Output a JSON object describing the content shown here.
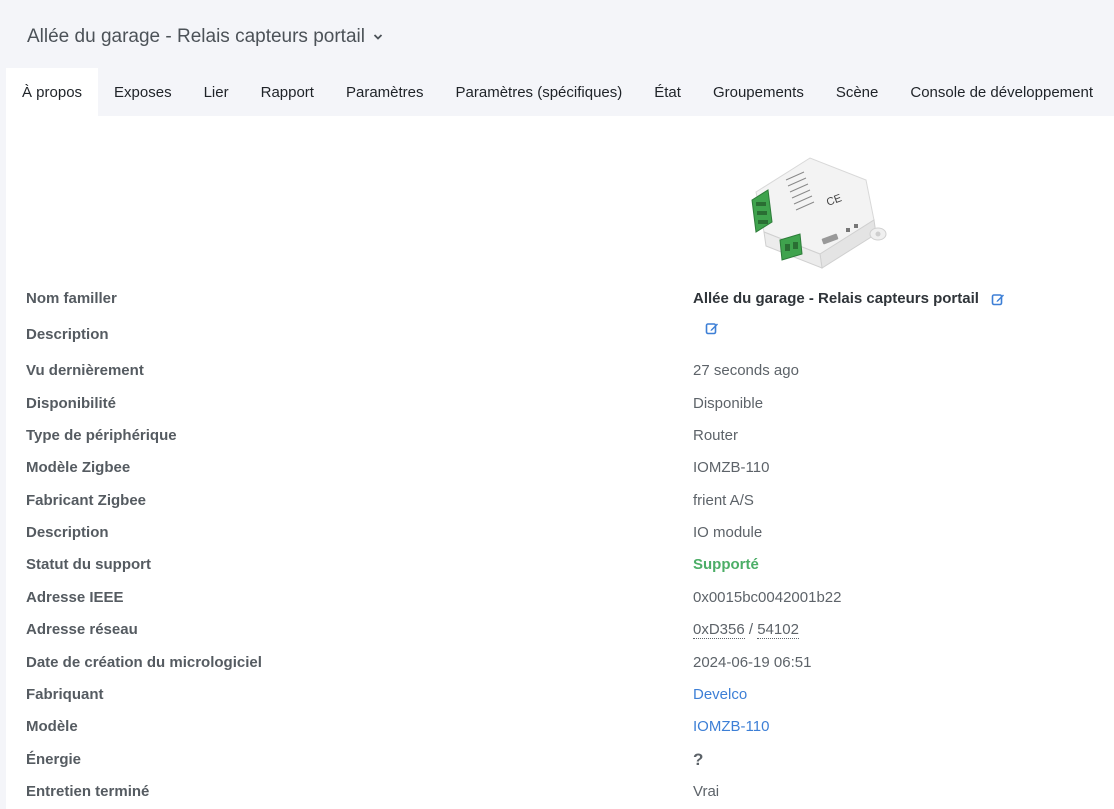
{
  "header": {
    "title": "Allée du garage - Relais capteurs portail"
  },
  "tabs": [
    {
      "label": "À propos",
      "active": true
    },
    {
      "label": "Exposes"
    },
    {
      "label": "Lier"
    },
    {
      "label": "Rapport"
    },
    {
      "label": "Paramètres"
    },
    {
      "label": "Paramètres (spécifiques)"
    },
    {
      "label": "État"
    },
    {
      "label": "Groupements"
    },
    {
      "label": "Scène"
    },
    {
      "label": "Console de développement"
    }
  ],
  "device_image_icon": "device-io-module-image",
  "details": {
    "friendly_name": {
      "label": "Nom familler",
      "value": "Allée du garage - Relais capteurs portail"
    },
    "description_edit": {
      "label": "Description"
    },
    "last_seen": {
      "label": "Vu dernièrement",
      "value": "27 seconds ago"
    },
    "availability": {
      "label": "Disponibilité",
      "value": "Disponible"
    },
    "device_type": {
      "label": "Type de périphérique",
      "value": "Router"
    },
    "zigbee_model": {
      "label": "Modèle Zigbee",
      "value": "IOMZB-110"
    },
    "zigbee_manufacturer": {
      "label": "Fabricant Zigbee",
      "value": "frient A/S"
    },
    "description": {
      "label": "Description",
      "value": "IO module"
    },
    "support_status": {
      "label": "Statut du support",
      "value": "Supporté"
    },
    "ieee_address": {
      "label": "Adresse IEEE",
      "value": "0x0015bc0042001b22"
    },
    "network_address": {
      "label": "Adresse réseau",
      "hex": "0xD356",
      "separator": " / ",
      "dec": "54102"
    },
    "firmware_date": {
      "label": "Date de création du micrologiciel",
      "value": "2024-06-19 06:51"
    },
    "manufacturer": {
      "label": "Fabriquant",
      "value": "Develco"
    },
    "model": {
      "label": "Modèle",
      "value": "IOMZB-110"
    },
    "power": {
      "label": "Énergie",
      "value": "?"
    },
    "interview_completed": {
      "label": "Entretien terminé",
      "value": "Vrai"
    }
  },
  "colors": {
    "background": "#f4f5f9",
    "supported_green": "#4cae67",
    "link_blue": "#3d7fd6",
    "edit_icon_blue": "#3d7fd6"
  }
}
